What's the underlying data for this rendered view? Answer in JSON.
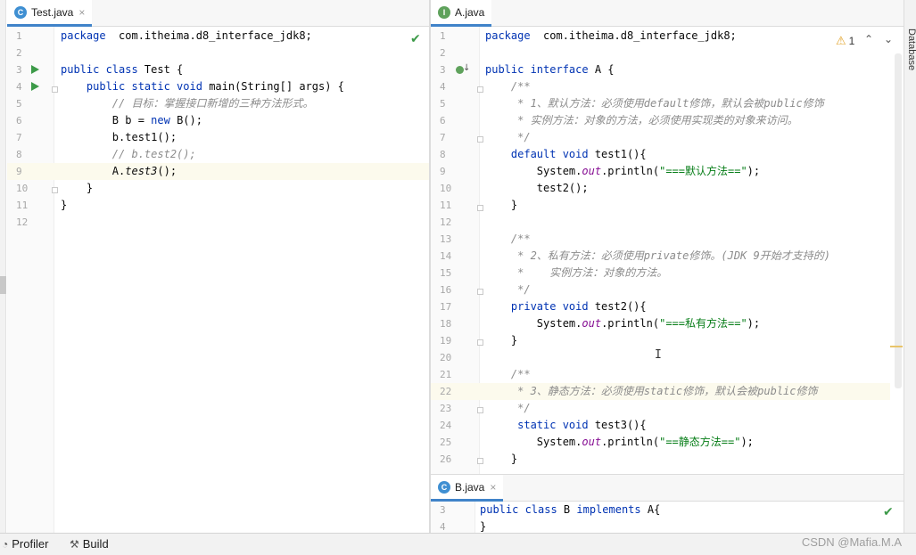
{
  "left_editor": {
    "tab": {
      "label": "Test.java",
      "icon": "C",
      "close": "×"
    },
    "lines": [
      {
        "n": "1",
        "tokens": [
          [
            "kw",
            "package"
          ],
          [
            "",
            "  com.itheima.d8_interface_jdk8;"
          ]
        ]
      },
      {
        "n": "2",
        "tokens": []
      },
      {
        "n": "3",
        "tokens": [
          [
            "kw",
            "public class "
          ],
          [
            "",
            "Test {"
          ]
        ]
      },
      {
        "n": "4",
        "tokens": [
          [
            "",
            "    "
          ],
          [
            "kw",
            "public static void "
          ],
          [
            "",
            "main(String[] args) {"
          ]
        ]
      },
      {
        "n": "5",
        "tokens": [
          [
            "",
            "        "
          ],
          [
            "cm",
            "// 目标：掌握接口新增的三种方法形式。"
          ]
        ]
      },
      {
        "n": "6",
        "tokens": [
          [
            "",
            "        B b = "
          ],
          [
            "kw",
            "new "
          ],
          [
            "",
            "B();"
          ]
        ]
      },
      {
        "n": "7",
        "tokens": [
          [
            "",
            "        b.test1();"
          ]
        ]
      },
      {
        "n": "8",
        "tokens": [
          [
            "",
            "        "
          ],
          [
            "cm",
            "// b.test2();"
          ]
        ]
      },
      {
        "n": "9",
        "tokens": [
          [
            "",
            "        A."
          ],
          [
            "it",
            "test3"
          ],
          [
            "",
            "();"
          ]
        ]
      },
      {
        "n": "10",
        "tokens": [
          [
            "",
            "    }"
          ]
        ]
      },
      {
        "n": "11",
        "tokens": [
          [
            "",
            "}"
          ]
        ]
      },
      {
        "n": "12",
        "tokens": []
      }
    ],
    "highlight_line": "9",
    "check": "✔"
  },
  "right_editor": {
    "tab": {
      "label": "A.java",
      "icon": "I",
      "close": ""
    },
    "warning_count": "1",
    "warning_icon": "⚠",
    "lines": [
      {
        "n": "1",
        "tokens": [
          [
            "kw",
            "package"
          ],
          [
            "",
            "  com.itheima.d8_interface_jdk8;"
          ]
        ]
      },
      {
        "n": "2",
        "tokens": []
      },
      {
        "n": "3",
        "tokens": [
          [
            "kw",
            "public interface "
          ],
          [
            "",
            "A {"
          ]
        ]
      },
      {
        "n": "4",
        "tokens": [
          [
            "",
            "    "
          ],
          [
            "cm",
            "/**"
          ]
        ]
      },
      {
        "n": "5",
        "tokens": [
          [
            "",
            "     "
          ],
          [
            "cm",
            "* 1、默认方法：必须使用default修饰，默认会被public修饰"
          ]
        ]
      },
      {
        "n": "6",
        "tokens": [
          [
            "",
            "     "
          ],
          [
            "cm",
            "* 实例方法：对象的方法，必须使用实现类的对象来访问。"
          ]
        ]
      },
      {
        "n": "7",
        "tokens": [
          [
            "",
            "     "
          ],
          [
            "cm",
            "*/"
          ]
        ]
      },
      {
        "n": "8",
        "tokens": [
          [
            "",
            "    "
          ],
          [
            "kw",
            "default void "
          ],
          [
            "",
            "test1(){"
          ]
        ]
      },
      {
        "n": "9",
        "tokens": [
          [
            "",
            "        System."
          ],
          [
            "fld",
            "out"
          ],
          [
            "",
            ".println("
          ],
          [
            "st",
            "\"===默认方法==\""
          ],
          [
            "",
            ");"
          ]
        ]
      },
      {
        "n": "10",
        "tokens": [
          [
            "",
            "        test2();"
          ]
        ]
      },
      {
        "n": "11",
        "tokens": [
          [
            "",
            "    }"
          ]
        ]
      },
      {
        "n": "12",
        "tokens": []
      },
      {
        "n": "13",
        "tokens": [
          [
            "",
            "    "
          ],
          [
            "cm",
            "/**"
          ]
        ]
      },
      {
        "n": "14",
        "tokens": [
          [
            "",
            "     "
          ],
          [
            "cm",
            "* 2、私有方法：必须使用private修饰。(JDK 9开始才支持的)"
          ]
        ]
      },
      {
        "n": "15",
        "tokens": [
          [
            "",
            "     "
          ],
          [
            "cm",
            "*    实例方法：对象的方法。"
          ]
        ]
      },
      {
        "n": "16",
        "tokens": [
          [
            "",
            "     "
          ],
          [
            "cm",
            "*/"
          ]
        ]
      },
      {
        "n": "17",
        "tokens": [
          [
            "",
            "    "
          ],
          [
            "kw",
            "private void "
          ],
          [
            "",
            "test2(){"
          ]
        ]
      },
      {
        "n": "18",
        "tokens": [
          [
            "",
            "        System."
          ],
          [
            "fld",
            "out"
          ],
          [
            "",
            ".println("
          ],
          [
            "st",
            "\"===私有方法==\""
          ],
          [
            "",
            ");"
          ]
        ]
      },
      {
        "n": "19",
        "tokens": [
          [
            "",
            "    }"
          ]
        ]
      },
      {
        "n": "20",
        "tokens": []
      },
      {
        "n": "21",
        "tokens": [
          [
            "",
            "    "
          ],
          [
            "cm",
            "/**"
          ]
        ]
      },
      {
        "n": "22",
        "tokens": [
          [
            "",
            "     "
          ],
          [
            "cm",
            "* 3、静态方法：必须使用static修饰，默认会被public修饰"
          ]
        ]
      },
      {
        "n": "23",
        "tokens": [
          [
            "",
            "     "
          ],
          [
            "cm",
            "*/"
          ]
        ]
      },
      {
        "n": "24",
        "tokens": [
          [
            "",
            "     "
          ],
          [
            "kw",
            "static void "
          ],
          [
            "",
            "test3(){"
          ]
        ]
      },
      {
        "n": "25",
        "tokens": [
          [
            "",
            "        System."
          ],
          [
            "fld",
            "out"
          ],
          [
            "",
            ".println("
          ],
          [
            "st",
            "\"==静态方法==\""
          ],
          [
            "",
            ");"
          ]
        ]
      },
      {
        "n": "26",
        "tokens": [
          [
            "",
            "    }"
          ]
        ]
      }
    ],
    "highlight_line": "22"
  },
  "bottom_editor": {
    "tab": {
      "label": "B.java",
      "icon": "C",
      "close": "×"
    },
    "lines": [
      {
        "n": "3",
        "tokens": [
          [
            "kw",
            "public class "
          ],
          [
            "",
            "B "
          ],
          [
            "kw",
            "implements "
          ],
          [
            "",
            "A{"
          ]
        ]
      },
      {
        "n": "4",
        "tokens": [
          [
            "",
            "}"
          ]
        ]
      }
    ],
    "check": "✔"
  },
  "side_panel": {
    "database_label": "Database"
  },
  "statusbar": {
    "profiler": "Profiler",
    "build": "Build"
  },
  "watermark": "CSDN @Mafia.M.A"
}
